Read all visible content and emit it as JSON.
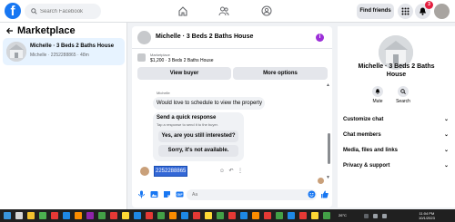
{
  "topbar": {
    "search_placeholder": "Search Facebook",
    "find_friends": "Find friends",
    "notifications_count": "3"
  },
  "left": {
    "title": "Marketplace",
    "conversation": {
      "title": "Michelle · 3 Beds 2 Baths House",
      "subtitle": "Michelle · 2252288865 · 48m"
    }
  },
  "chat": {
    "title": "Michelle · 3 Beds 2 Baths House",
    "marketplace_label": "Marketplace",
    "listing": "$1,200 · 3 Beds 2 Baths House",
    "view_buyer": "View buyer",
    "more_options": "More options",
    "sender_name": "Michelle",
    "incoming_message": "Would love to schedule to view the property",
    "quick_response_title": "Send a quick response",
    "quick_response_sub": "Tap a response to send it to the buyer.",
    "quick_options": [
      "Yes, are you still interested?",
      "Sorry, it's not available."
    ],
    "selected_message": "2252288865",
    "composer_placeholder": "Aa"
  },
  "right": {
    "title_line1": "Michelle · 3 Beds 2 Baths",
    "title_line2": "House",
    "mute_label": "Mute",
    "search_label": "Search",
    "rows": [
      "Customize chat",
      "Chat members",
      "Media, files and links",
      "Privacy & support"
    ]
  },
  "taskbar": {
    "weather": "26°C",
    "time": "11:04 PM",
    "date": "10/1/2023"
  },
  "colors": {
    "brand": "#1877f2",
    "selection": "#3367d6",
    "info": "#9c2fd8"
  }
}
